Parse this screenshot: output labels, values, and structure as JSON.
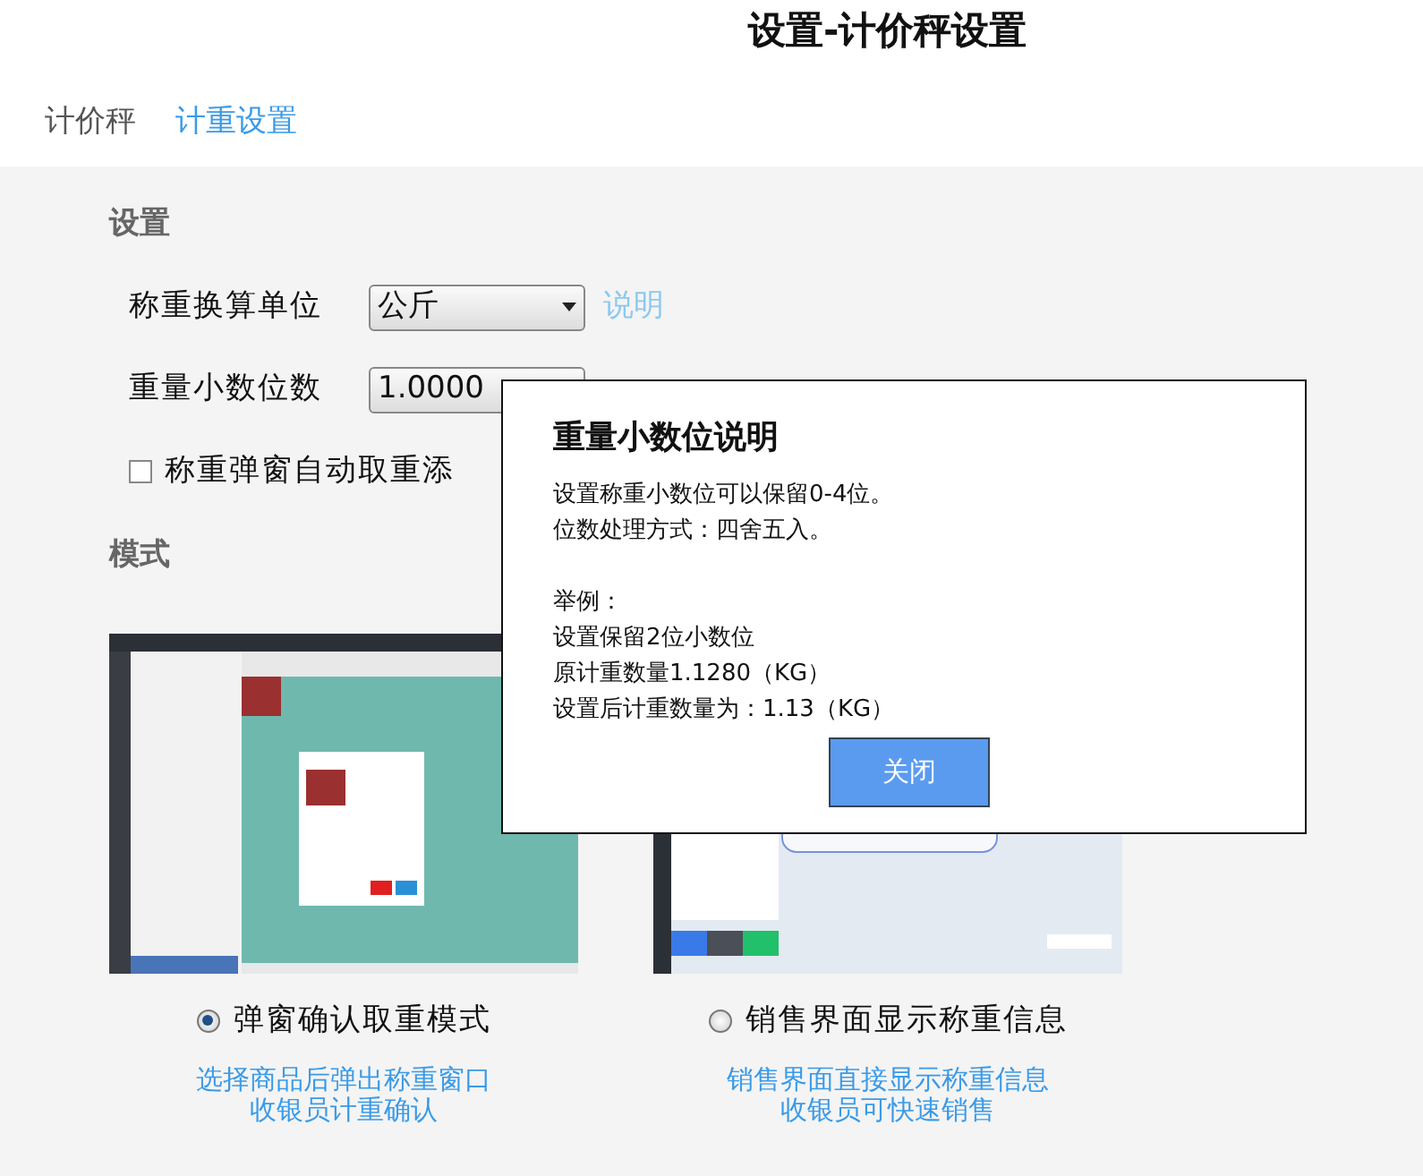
{
  "title": "设置-计价秤设置",
  "tabs": [
    {
      "label": "计价秤",
      "selected": false
    },
    {
      "label": "计重设置",
      "selected": true
    }
  ],
  "settings": {
    "heading": "设置",
    "fields": [
      {
        "kind": "select",
        "label": "称重换算单位",
        "value": "公斤",
        "link": "说明"
      },
      {
        "kind": "select",
        "label": "重量小数位数",
        "value": "1.0000"
      },
      {
        "kind": "checkbox",
        "label": "称重弹窗自动取重添",
        "checked": false
      }
    ]
  },
  "mode": {
    "heading": "模式",
    "options": [
      {
        "selected": true,
        "label": "弹窗确认取重模式",
        "description": [
          "选择商品后弹出称重窗口",
          "收银员计重确认"
        ]
      },
      {
        "selected": false,
        "label": "销售界面显示称重信息",
        "description": [
          "销售界面直接显示称重信息",
          "收银员可快速销售"
        ]
      }
    ]
  },
  "dialog": {
    "title": "重量小数位说明",
    "paragraphs": [
      [
        "设置称重小数位可以保留0-4位。",
        "位数处理方式：四舍五入。"
      ],
      [
        "举例：",
        "设置保留2位小数位",
        "原计重数量1.1280（KG）",
        "设置后计重数量为：1.13（KG）"
      ]
    ],
    "button": "关闭"
  }
}
